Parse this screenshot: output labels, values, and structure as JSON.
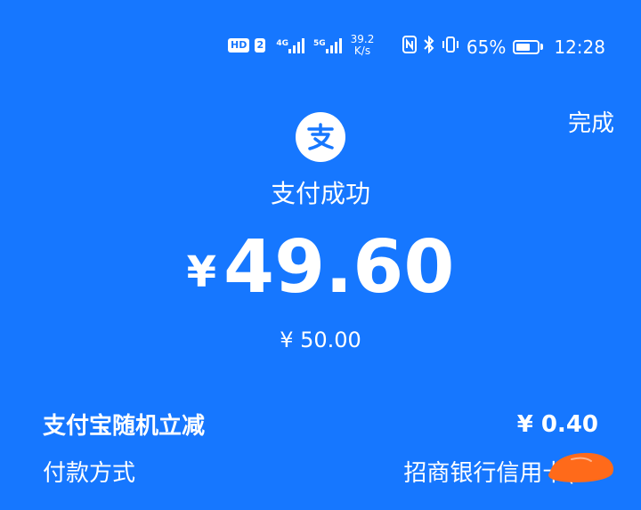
{
  "status_bar": {
    "hd": "HD",
    "sim": "2",
    "net1": "4G",
    "net2": "5G",
    "speed_value": "39.2",
    "speed_unit": "K/s",
    "battery": "65%",
    "time": "12:28",
    "battery_level": 0.65
  },
  "header": {
    "done_label": "完成"
  },
  "payment": {
    "status_title": "支付成功",
    "currency_symbol": "¥",
    "amount": "49.60",
    "original_amount": "¥ 50.00"
  },
  "details": [
    {
      "label": "支付宝随机立减",
      "value": "¥ 0.40"
    },
    {
      "label": "付款方式",
      "value": "招商银行信用卡(3"
    }
  ],
  "colors": {
    "background": "#1677ff",
    "text": "#ffffff",
    "redaction": "#ff6a1a"
  }
}
